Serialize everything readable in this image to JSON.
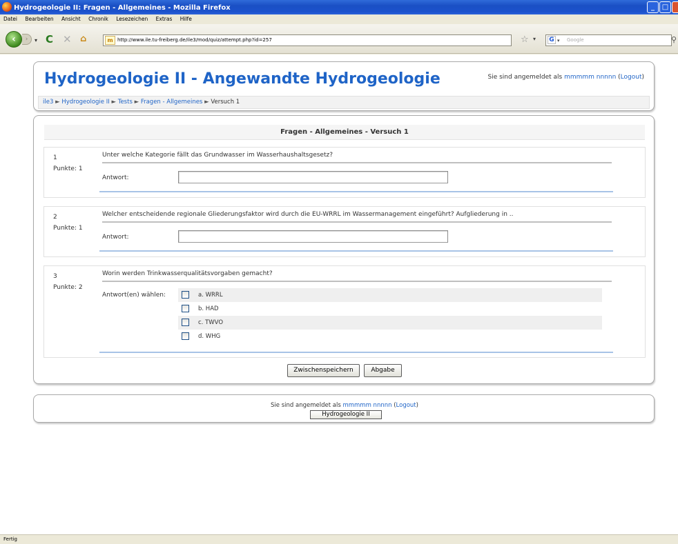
{
  "window": {
    "title": "Hydrogeologie II: Fragen - Allgemeines - Mozilla Firefox"
  },
  "menu": [
    "Datei",
    "Bearbeiten",
    "Ansicht",
    "Chronik",
    "Lesezeichen",
    "Extras",
    "Hilfe"
  ],
  "nav": {
    "url": "http://www.ile.tu-freiberg.de/ile3/mod/quiz/attempt.php?id=257",
    "search_placeholder": "Google"
  },
  "header": {
    "title": "Hydrogeologie II - Angewandte Hydrogeologie",
    "login_prefix": "Sie sind angemeldet als ",
    "user": "mmmmm nnnnn",
    "logout": "Logout"
  },
  "breadcrumb": [
    "ile3",
    "Hydrogeologie II",
    "Tests",
    "Fragen - Allgemeines",
    "Versuch 1"
  ],
  "quiz": {
    "title": "Fragen - Allgemeines - Versuch 1",
    "questions": [
      {
        "num": "1",
        "points": "Punkte: 1",
        "text": "Unter welche Kategorie fällt das Grundwasser im Wasserhaushaltsgesetz?",
        "answer_label": "Antwort:",
        "answer_value": ""
      },
      {
        "num": "2",
        "points": "Punkte: 1",
        "text": "Welcher entscheidende regionale Gliederungsfaktor wird durch die EU-WRRL im Wassermanagement eingeführt? Aufgliederung in ..",
        "answer_label": "Antwort:",
        "answer_value": ""
      },
      {
        "num": "3",
        "points": "Punkte: 2",
        "text": "Worin werden Trinkwasserqualitätsvorgaben gemacht?",
        "answer_label": "Antwort(en) wählen:",
        "options": [
          "a. WRRL",
          "b. HAD",
          "c. TWVO",
          "d. WHG"
        ]
      }
    ],
    "save_button": "Zwischenspeichern",
    "submit_button": "Abgabe"
  },
  "footer": {
    "login_prefix": "Sie sind angemeldet als ",
    "user": "mmmmm nnnnn",
    "logout": "Logout",
    "course_button": "Hydrogeologie II"
  },
  "status": "Fertig"
}
